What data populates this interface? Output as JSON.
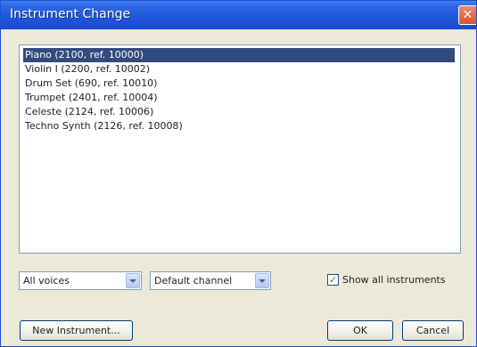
{
  "window": {
    "title": "Instrument Change",
    "close_glyph": "✕"
  },
  "instruments": {
    "items": [
      {
        "label": "Piano (2100, ref. 10000)",
        "selected": true
      },
      {
        "label": "Violin I (2200, ref. 10002)",
        "selected": false
      },
      {
        "label": "Drum Set (690, ref. 10010)",
        "selected": false
      },
      {
        "label": "Trumpet (2401, ref. 10004)",
        "selected": false
      },
      {
        "label": "Celeste (2124, ref. 10006)",
        "selected": false
      },
      {
        "label": "Techno Synth (2126, ref. 10008)",
        "selected": false
      }
    ]
  },
  "filters": {
    "voices_value": "All voices",
    "channel_value": "Default channel",
    "show_all_label": "Show all instruments",
    "show_all_checked": true,
    "check_glyph": "✓"
  },
  "buttons": {
    "new_instrument": "New Instrument...",
    "ok": "OK",
    "cancel": "Cancel"
  },
  "colors": {
    "titlebar": "#2059d8",
    "selection": "#324a7c",
    "dialog_bg": "#ece9d8"
  }
}
